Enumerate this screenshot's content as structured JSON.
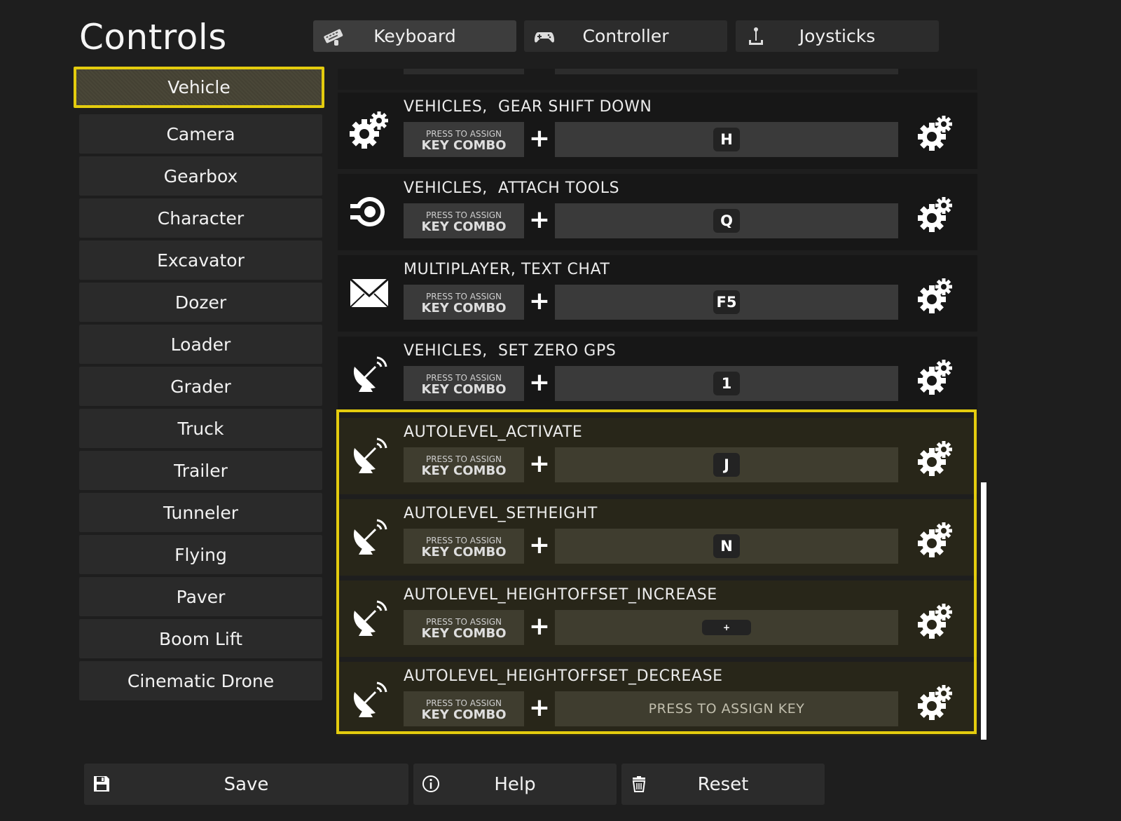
{
  "title": "Controls",
  "tabs": [
    {
      "label": "Keyboard",
      "icon": "keyboard-icon",
      "active": true
    },
    {
      "label": "Controller",
      "icon": "gamepad-icon",
      "active": false
    },
    {
      "label": "Joysticks",
      "icon": "joystick-icon",
      "active": false
    }
  ],
  "sidebar": {
    "items": [
      {
        "label": "Vehicle",
        "selected": true
      },
      {
        "label": "Camera"
      },
      {
        "label": "Gearbox"
      },
      {
        "label": "Character"
      },
      {
        "label": "Excavator"
      },
      {
        "label": "Dozer"
      },
      {
        "label": "Loader"
      },
      {
        "label": "Grader"
      },
      {
        "label": "Truck"
      },
      {
        "label": "Trailer"
      },
      {
        "label": "Tunneler"
      },
      {
        "label": "Flying"
      },
      {
        "label": "Paver"
      },
      {
        "label": "Boom Lift"
      },
      {
        "label": "Cinematic Drone"
      }
    ]
  },
  "combo": {
    "small_label": "PRESS TO ASSIGN",
    "big_label": "KEY COMBO"
  },
  "plus_sign": "+",
  "bindings": [
    {
      "label": "VEHICLES,  GEAR SHIFT DOWN",
      "key": "H",
      "icon": "gears-icon"
    },
    {
      "label": "VEHICLES,  ATTACH TOOLS",
      "key": "Q",
      "icon": "attach-tool-icon"
    },
    {
      "label": "MULTIPLAYER, TEXT CHAT",
      "key": "F5",
      "icon": "envelope-icon"
    },
    {
      "label": "VEHICLES,  SET ZERO GPS",
      "key": "1",
      "icon": "satellite-dish-icon"
    },
    {
      "label": "AUTOLEVEL_ACTIVATE",
      "key": "J",
      "icon": "satellite-dish-icon",
      "highlighted": true
    },
    {
      "label": "AUTOLEVEL_SETHEIGHT",
      "key": "N",
      "icon": "satellite-dish-icon",
      "highlighted": true
    },
    {
      "label": "AUTOLEVEL_HEIGHTOFFSET_INCREASE",
      "key": "+",
      "icon": "satellite-dish-icon",
      "highlighted": true
    },
    {
      "label": "AUTOLEVEL_HEIGHTOFFSET_DECREASE",
      "key": "",
      "placeholder": "PRESS TO ASSIGN KEY",
      "icon": "satellite-dish-icon",
      "highlighted": true
    }
  ],
  "footer": {
    "save_label": "Save",
    "help_label": "Help",
    "reset_label": "Reset"
  },
  "colors": {
    "accent": "#e4cc0e",
    "background": "#1e1e1e",
    "row_background": "#171717",
    "highlight_row": "#282619"
  }
}
